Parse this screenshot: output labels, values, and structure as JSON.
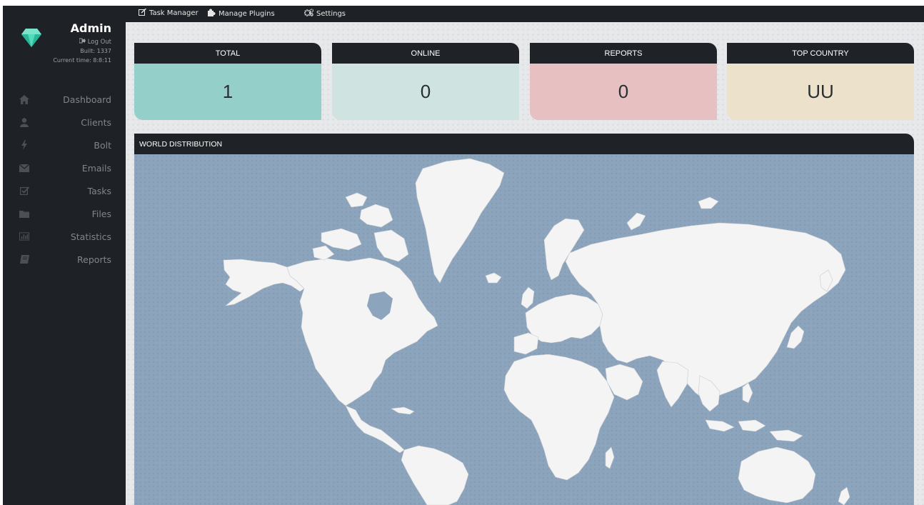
{
  "sidebar": {
    "user_name": "Admin",
    "logout_label": "Log Out",
    "build_text": "Built: 1337",
    "time_text": "Current time: 8:8:11",
    "items": [
      {
        "label": "Dashboard",
        "icon": "home-icon"
      },
      {
        "label": "Clients",
        "icon": "user-icon"
      },
      {
        "label": "Bolt",
        "icon": "bolt-icon"
      },
      {
        "label": "Emails",
        "icon": "envelope-icon"
      },
      {
        "label": "Tasks",
        "icon": "checkbox-icon"
      },
      {
        "label": "Files",
        "icon": "folder-icon"
      },
      {
        "label": "Statistics",
        "icon": "bar-chart-icon"
      },
      {
        "label": "Reports",
        "icon": "book-icon"
      }
    ]
  },
  "topbar": {
    "task_manager": "Task Manager",
    "manage_plugins": "Manage Plugins",
    "settings": "Settings"
  },
  "stats": [
    {
      "title": "TOTAL",
      "value": "1",
      "color": "#94cfca"
    },
    {
      "title": "ONLINE",
      "value": "0",
      "color": "#cfe4e0"
    },
    {
      "title": "REPORTS",
      "value": "0",
      "color": "#e7c1c1"
    },
    {
      "title": "TOP COUNTRY",
      "value": "UU",
      "color": "#ece2cb"
    }
  ],
  "world": {
    "title": "WORLD DISTRIBUTION",
    "ocean_color": "#8da4bd",
    "land_color": "#f4f4f4"
  }
}
